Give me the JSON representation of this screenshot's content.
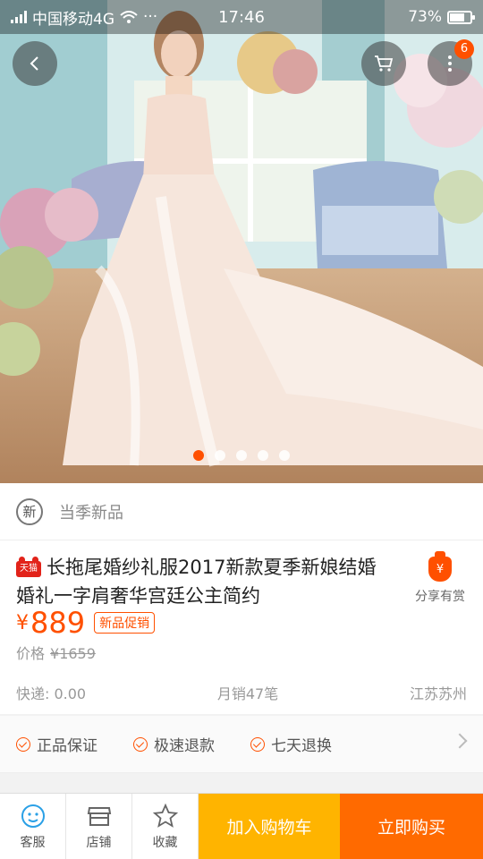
{
  "status_bar": {
    "carrier": "中国移动4G",
    "dots": "···",
    "time": "17:46",
    "battery": "73%",
    "battery_level": 0.73
  },
  "hero": {
    "cart_badge": "6",
    "carousel_total": 5,
    "carousel_active": 0
  },
  "product": {
    "new_circle": "新",
    "new_label": "当季新品",
    "tmall_label": "天猫",
    "title": "长拖尾婚纱礼服2017新款夏季新娘结婚婚礼一字肩奢华宫廷公主简约",
    "share_icon": "¥",
    "share_label": "分享有赏",
    "currency": "¥",
    "price": "889",
    "promo_tag": "新品促销",
    "orig_label": "价格",
    "orig_price": "¥1659",
    "shipping": "快递: 0.00",
    "monthly_sales": "月销47笔",
    "location": "江苏苏州"
  },
  "guarantees": [
    "正品保证",
    "极速退款",
    "七天退换"
  ],
  "bottom_bar": {
    "service": "客服",
    "shop": "店铺",
    "favorite": "收藏",
    "add_cart": "加入购物车",
    "buy_now": "立即购买"
  },
  "colors": {
    "accent": "#ff5000",
    "cart_button": "#ffb400",
    "buy_button": "#ff6a00",
    "tmall": "#e2231a"
  }
}
